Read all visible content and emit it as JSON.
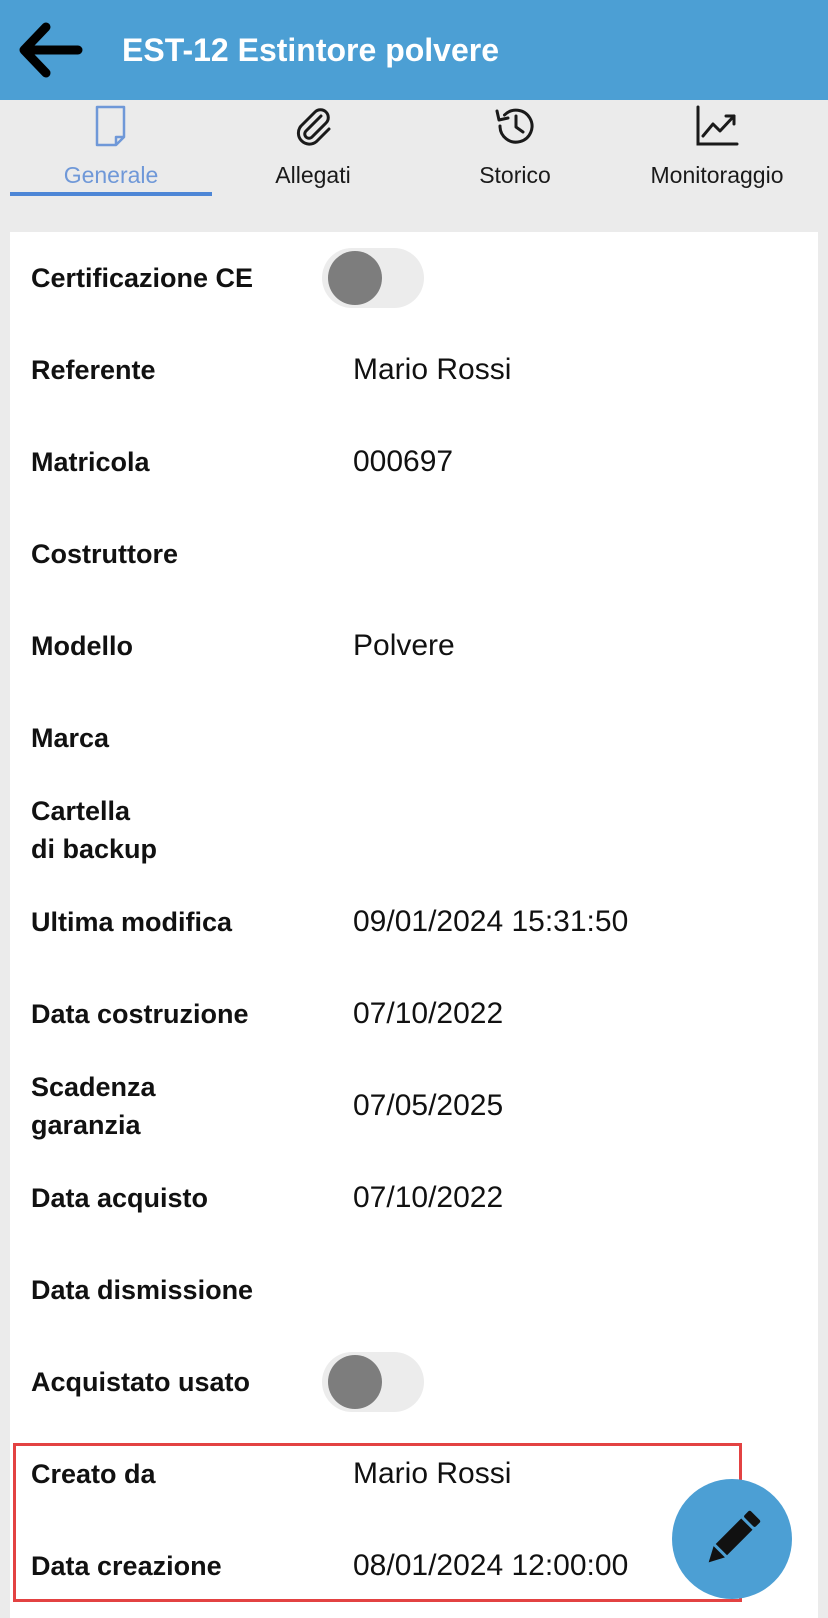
{
  "appbar": {
    "title": "EST-12 Estintore polvere",
    "back_icon": "arrow-left-icon",
    "color": "#4c9fd4"
  },
  "tabs": [
    {
      "label": "Generale",
      "icon": "document-icon",
      "active": true
    },
    {
      "label": "Allegati",
      "icon": "paperclip-icon",
      "active": false
    },
    {
      "label": "Storico",
      "icon": "history-icon",
      "active": false
    },
    {
      "label": "Monitoraggio",
      "icon": "chart-line-icon",
      "active": false
    }
  ],
  "fields": {
    "certificazione_ce": {
      "label": "Certificazione CE",
      "on": false
    },
    "referente": {
      "label": "Referente",
      "value": "Mario Rossi"
    },
    "matricola": {
      "label": "Matricola",
      "value": "000697"
    },
    "costruttore": {
      "label": "Costruttore",
      "value": ""
    },
    "modello": {
      "label": "Modello",
      "value": "Polvere"
    },
    "marca": {
      "label": "Marca",
      "value": ""
    },
    "cartella_backup": {
      "label": "Cartella\ndi backup",
      "value": ""
    },
    "ultima_modifica": {
      "label": "Ultima modifica",
      "value": "09/01/2024 15:31:50"
    },
    "data_costruzione": {
      "label": "Data costruzione",
      "value": "07/10/2022"
    },
    "scadenza_garanzia": {
      "label": "Scadenza\ngaranzia",
      "value": "07/05/2025"
    },
    "data_acquisto": {
      "label": "Data acquisto",
      "value": "07/10/2022"
    },
    "data_dismissione": {
      "label": "Data dismissione",
      "value": ""
    },
    "acquistato_usato": {
      "label": "Acquistato usato",
      "on": false
    },
    "creato_da": {
      "label": "Creato da",
      "value": "Mario Rossi"
    },
    "data_creazione": {
      "label": "Data creazione",
      "value": "08/01/2024 12:00:00"
    }
  },
  "fab": {
    "icon": "pencil-icon"
  }
}
